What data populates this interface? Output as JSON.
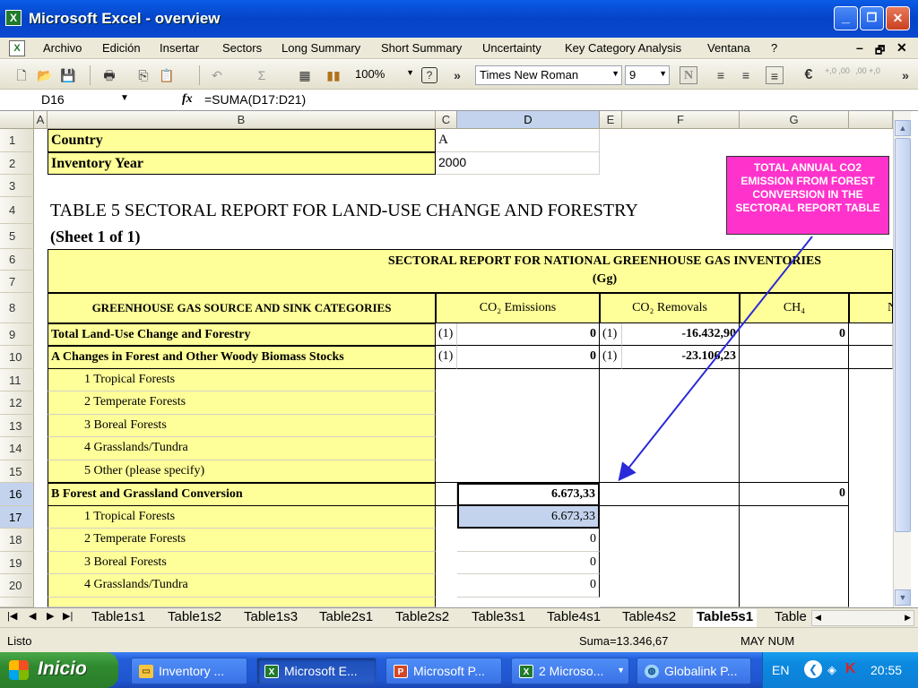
{
  "window": {
    "title": "Microsoft Excel - overview",
    "min": "_",
    "restore": "❐",
    "close": "✕"
  },
  "menu": {
    "items": [
      "Archivo",
      "Edición",
      "Insertar",
      "Sectors",
      "Long Summary",
      "Short Summary",
      "Uncertainty",
      "Key Category Analysis",
      "Ventana",
      "?"
    ],
    "mdi_min": "–",
    "mdi_restore": "🗗",
    "mdi_close": "✕"
  },
  "toolbar": {
    "zoom": "100%",
    "font": "Times New Roman",
    "size": "9",
    "bold": "N",
    "euro": "€",
    "inc_dec": "+,0 ,00",
    "dec_dec": ",00 +,0",
    "overflow1": "»",
    "overflow2": "»"
  },
  "formula_bar": {
    "name_box": "D16",
    "fx": "fx",
    "formula": "=SUMA(D17:D21)"
  },
  "columns": [
    "A",
    "B",
    "C",
    "D",
    "E",
    "F",
    "G",
    ""
  ],
  "rows": [
    "1",
    "2",
    "3",
    "4",
    "5",
    "6",
    "7",
    "8",
    "9",
    "10",
    "11",
    "12",
    "13",
    "14",
    "15",
    "16",
    "17",
    "18",
    "19",
    "20"
  ],
  "sheet": {
    "country_label": "Country",
    "country_value": "A",
    "year_label": "Inventory Year",
    "year_value": "2000",
    "table_title": "TABLE 5 SECTORAL REPORT FOR LAND-USE CHANGE AND FORESTRY",
    "sheet_note": "(Sheet 1 of 1)",
    "report_header": "SECTORAL REPORT FOR NATIONAL GREENHOUSE GAS INVENTORIES",
    "units": "(Gg)",
    "cat_header": "GREENHOUSE GAS SOURCE AND SINK CATEGORIES",
    "h_co2e": "CO₂ Emissions",
    "h_co2r": "CO₂ Removals",
    "h_ch4": "CH₄",
    "h_next": "N",
    "r9": {
      "label": "Total Land-Use Change and Forestry",
      "c": "(1)",
      "d": "0",
      "e": "(1)",
      "f": "-16.432,90",
      "g": "0"
    },
    "r10": {
      "label": "A   Changes in Forest and Other Woody Biomass Stocks",
      "c": "(1)",
      "d": "0",
      "e": "(1)",
      "f": "-23.106,23"
    },
    "r11": "1  Tropical Forests",
    "r12": "2  Temperate Forests",
    "r13": "3  Boreal Forests",
    "r14": "4  Grasslands/Tundra",
    "r15": "5  Other (please specify)",
    "r16": {
      "label": "B  Forest and Grassland Conversion",
      "d": "6.673,33",
      "g": "0"
    },
    "r17": {
      "label": "1  Tropical Forests",
      "d": "6.673,33"
    },
    "r18": {
      "label": "2  Temperate Forests",
      "d": "0"
    },
    "r19": {
      "label": "3  Boreal Forests",
      "d": "0"
    },
    "r20": {
      "label": "4  Grasslands/Tundra",
      "d": "0"
    }
  },
  "callout": "TOTAL ANNUAL CO2 EMISSION FROM FOREST CONVERSION IN THE SECTORAL REPORT TABLE",
  "tabs": [
    "Table1s1",
    "Table1s2",
    "Table1s3",
    "Table2s1",
    "Table2s2",
    "Table3s1",
    "Table4s1",
    "Table4s2",
    "Table5s1",
    "Table"
  ],
  "active_tab": "Table5s1",
  "status": {
    "ready": "Listo",
    "sum": "Suma=13.346,67",
    "indicators": "MAY NUM"
  },
  "taskbar": {
    "start": "Inicio",
    "tasks": [
      "Inventory ...",
      "Microsoft E...",
      "Microsoft P...",
      "2 Microso...",
      "Globalink P..."
    ],
    "lang": "EN",
    "clock": "20:55"
  },
  "colors": {
    "yellow": "#ffff99",
    "callout": "#ff33cc",
    "selection": "#c3d3ed",
    "xp_blue": "#0543c8"
  }
}
